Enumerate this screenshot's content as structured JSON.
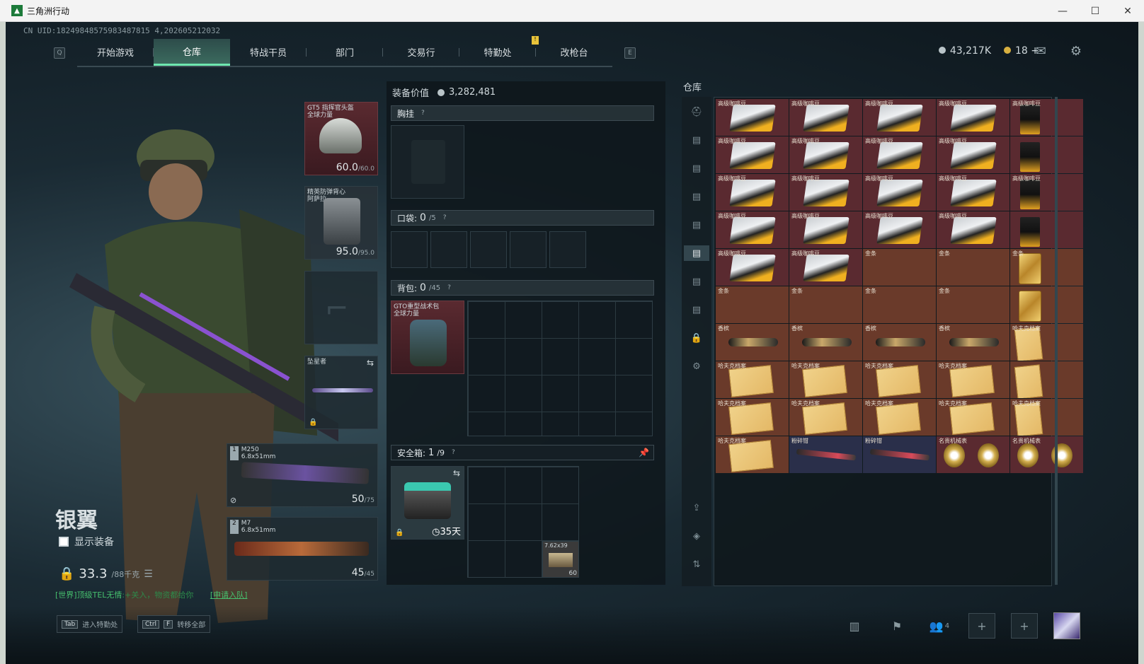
{
  "window": {
    "title": "三角洲行动",
    "controls": [
      "—",
      "☐",
      "✕"
    ]
  },
  "uid": "CN UID:18249848575983487815 4,202605212032",
  "nav": {
    "left_key": "Q",
    "right_key": "E",
    "tabs": [
      "开始游戏",
      "仓库",
      "特战干员",
      "部门",
      "交易行",
      "特勤处",
      "改枪台"
    ],
    "active": "仓库"
  },
  "currency": {
    "silver": "43,217K",
    "gold": "18 +"
  },
  "operator": {
    "name": "银翼",
    "show_equipment": "显示装备",
    "weight": "33.3",
    "weight_max": "/88千克"
  },
  "chat": {
    "channel": "[世界]",
    "player": "顶级TEL无情",
    "text": ":+关入，物资都给你",
    "link": "[申请入队]"
  },
  "gear": {
    "helmet": {
      "name": "GT5 指挥官头盔",
      "sub": "全球力量",
      "durability": "60.0",
      "max": "/60.0"
    },
    "armor": {
      "name": "精英防弹背心",
      "sub": "阿萨拉",
      "durability": "95.0",
      "max": "/95.0"
    },
    "melee": {
      "name": "坠星者"
    },
    "weapon1": {
      "slot": "1",
      "name": "M250",
      "ammo": "6.8x51mm",
      "count": "50",
      "max": "/75"
    },
    "weapon2": {
      "slot": "2",
      "name": "M7",
      "ammo": "6.8x51mm",
      "count": "45",
      "max": "/45"
    }
  },
  "loadout": {
    "value_label": "装备价值",
    "value": "3,282,481",
    "chest_rig": "胸挂",
    "pockets": "口袋:",
    "pockets_count": "0",
    "pockets_max": "/5",
    "backpack": "背包:",
    "backpack_count": "0",
    "backpack_max": "/45",
    "backpack_item": "GTO重型战术包",
    "backpack_item_sub": "全球力量",
    "safe_box": "安全箱:",
    "safe_count": "1",
    "safe_max": "/9",
    "safe_timer": "35天",
    "ammo_item": "7.62x39",
    "ammo_count": "60"
  },
  "storage": {
    "title": "仓库",
    "items": [
      {
        "label": "高级咖啡豆",
        "kind": "coffee"
      },
      {
        "label": "高级咖啡豆",
        "kind": "coffee"
      },
      {
        "label": "高级咖啡豆",
        "kind": "coffee"
      },
      {
        "label": "高级咖啡豆",
        "kind": "coffee"
      },
      {
        "label": "高级咖啡豆",
        "kind": "bag"
      },
      {
        "label": "高级咖啡豆",
        "kind": "coffee"
      },
      {
        "label": "高级咖啡豆",
        "kind": "coffee"
      },
      {
        "label": "高级咖啡豆",
        "kind": "coffee"
      },
      {
        "label": "高级咖啡豆",
        "kind": "coffee"
      },
      {
        "label": "",
        "kind": "bag"
      },
      {
        "label": "高级咖啡豆",
        "kind": "coffee"
      },
      {
        "label": "高级咖啡豆",
        "kind": "coffee"
      },
      {
        "label": "高级咖啡豆",
        "kind": "coffee"
      },
      {
        "label": "高级咖啡豆",
        "kind": "coffee"
      },
      {
        "label": "高级咖啡豆",
        "kind": "bag"
      },
      {
        "label": "高级咖啡豆",
        "kind": "coffee"
      },
      {
        "label": "高级咖啡豆",
        "kind": "coffee"
      },
      {
        "label": "高级咖啡豆",
        "kind": "coffee"
      },
      {
        "label": "高级咖啡豆",
        "kind": "coffee"
      },
      {
        "label": "",
        "kind": "bag"
      },
      {
        "label": "高级咖啡豆",
        "kind": "coffee"
      },
      {
        "label": "高级咖啡豆",
        "kind": "coffee"
      },
      {
        "label": "金条",
        "kind": "gold"
      },
      {
        "label": "金条",
        "kind": "gold"
      },
      {
        "label": "金条",
        "kind": "goldv"
      },
      {
        "label": "金条",
        "kind": "gold"
      },
      {
        "label": "金条",
        "kind": "gold"
      },
      {
        "label": "金条",
        "kind": "gold"
      },
      {
        "label": "金条",
        "kind": "gold"
      },
      {
        "label": "",
        "kind": "goldv"
      },
      {
        "label": "香槟",
        "kind": "champ"
      },
      {
        "label": "香槟",
        "kind": "champ"
      },
      {
        "label": "香槟",
        "kind": "champ"
      },
      {
        "label": "香槟",
        "kind": "champ"
      },
      {
        "label": "哈夫克档案",
        "kind": "docv"
      },
      {
        "label": "哈夫克档案",
        "kind": "docs"
      },
      {
        "label": "哈夫克档案",
        "kind": "docs"
      },
      {
        "label": "哈夫克档案",
        "kind": "docs"
      },
      {
        "label": "哈夫克档案",
        "kind": "docs"
      },
      {
        "label": "",
        "kind": "docv"
      },
      {
        "label": "哈夫克档案",
        "kind": "docs"
      },
      {
        "label": "哈夫克档案",
        "kind": "docs"
      },
      {
        "label": "哈夫克档案",
        "kind": "docs"
      },
      {
        "label": "哈夫克档案",
        "kind": "docs"
      },
      {
        "label": "哈夫克档案",
        "kind": "docv"
      },
      {
        "label": "哈夫克档案",
        "kind": "docs"
      },
      {
        "label": "粉碎钳",
        "kind": "shears"
      },
      {
        "label": "粉碎钳",
        "kind": "shears"
      },
      {
        "label": "名贵机械表",
        "kind": "watch"
      },
      {
        "label": "名贵机械表",
        "kind": "watch"
      }
    ]
  },
  "bottom": {
    "hint1_key": "Tab",
    "hint1": "进入特勤处",
    "hint2_key1": "Ctrl",
    "hint2_key2": "F",
    "hint2": "转移全部",
    "squad_count": "4"
  }
}
